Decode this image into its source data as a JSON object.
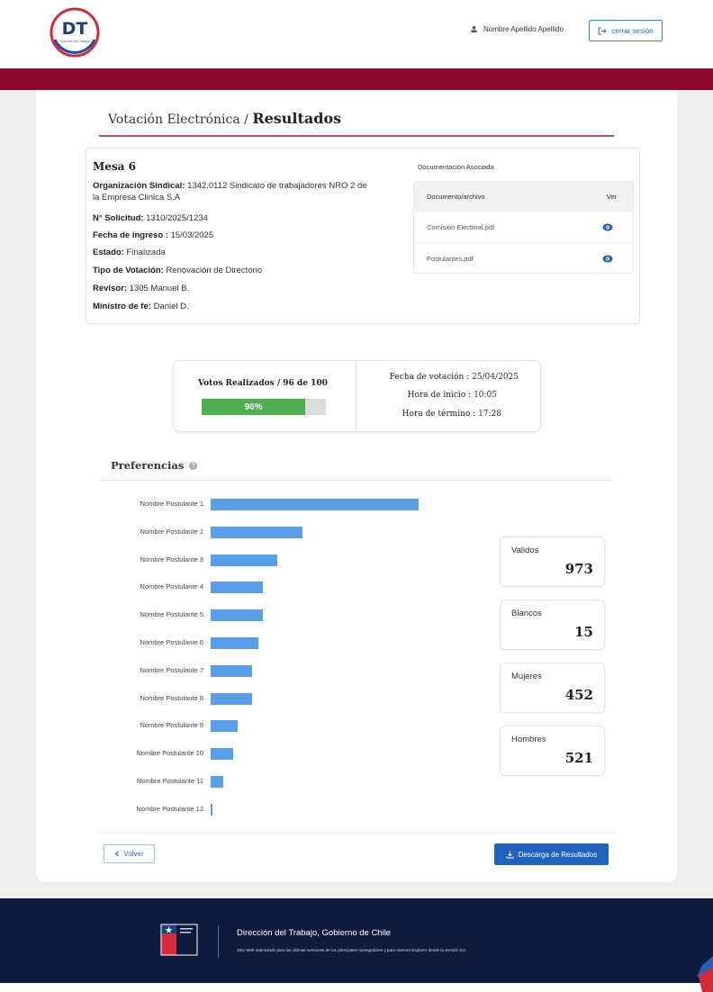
{
  "header": {
    "logo_text": "DT",
    "logo_subtext": "Dirección del Trabajo",
    "user_name": "Nombre Apellido Apellido",
    "logout_label": "cerrar sesión"
  },
  "breadcrumb": {
    "parent": "Votación Electrónica /",
    "current": "Resultados"
  },
  "mesa": {
    "title": "Mesa 6",
    "fields": [
      {
        "label": "Organización Sindical:",
        "value": "1342.0112 Sindicato de trabajadores NRO 2 de la Empresa Clinica S.A"
      },
      {
        "label": "N° Solicitud:",
        "value": "1310/2025/1234"
      },
      {
        "label": "Fecha de ingreso :",
        "value": "15/03/2025"
      },
      {
        "label": "Estado:",
        "value": "Finalizada"
      },
      {
        "label": "Tipo de Votación:",
        "value": "Renovación de Directorio"
      },
      {
        "label": "Revisor:",
        "value": "1305 Manuel B."
      },
      {
        "label": "Ministro de fe:",
        "value": "Daniel D."
      }
    ]
  },
  "documents": {
    "heading": "Documentación Asociada",
    "col_file": "Documento/archivo",
    "col_view": "Ver",
    "rows": [
      {
        "name": "Comisión Electoral.pdf",
        "icon": "eye-icon"
      },
      {
        "name": "Postulantes.pdf",
        "icon": "eye-icon"
      }
    ]
  },
  "votes": {
    "label": "Votos Realizados / 96 de 100",
    "progress": 0.96,
    "progress_text": "96%",
    "fecha_label": "Fecha de votación :",
    "fecha_value": "25/04/2025",
    "inicio_label": "Hora de inicio :",
    "inicio_value": "10:05",
    "termino_label": "Hora de término :",
    "termino_value": "17:28"
  },
  "preferences": {
    "title": "Preferencias"
  },
  "chart_data": {
    "type": "bar",
    "orientation": "horizontal",
    "categories": [
      "Nombre Postulante 1",
      "Nombre Postulante 2",
      "Nombre Postulante 3",
      "Nombre Postulante 4",
      "Nombre Postulante 5",
      "Nombre Postulante 6",
      "Nombre Postulante 7",
      "Nombre Postulante 8",
      "Nombre Postulante 9",
      "Nombre Postulante 10",
      "Nombre Postulante 11",
      "Nombre Postulante 12"
    ],
    "values": [
      100,
      44,
      32,
      25,
      25,
      23,
      20,
      20,
      13,
      11,
      6,
      1
    ],
    "color": "#5a9de8",
    "grid": false
  },
  "stats": [
    {
      "label": "Validos",
      "value": "973"
    },
    {
      "label": "Blancos",
      "value": "15"
    },
    {
      "label": "Mujeres",
      "value": "452"
    },
    {
      "label": "Hombres",
      "value": "521"
    }
  ],
  "actions": {
    "back_label": "Volver",
    "download_label": "Descarga de Resultados"
  },
  "footer": {
    "title": "Dirección del Trabajo, Gobierno de Chile",
    "subtitle": "Sitio Web optimizado para las últimas versiones de los principales navegadores y para Internet Explorer desde la versión 8.0"
  },
  "colors": {
    "brand": "#8c0a2d",
    "accent": "#1f63bd",
    "progress": "#4caf50",
    "footer": "#0f1b3d"
  }
}
